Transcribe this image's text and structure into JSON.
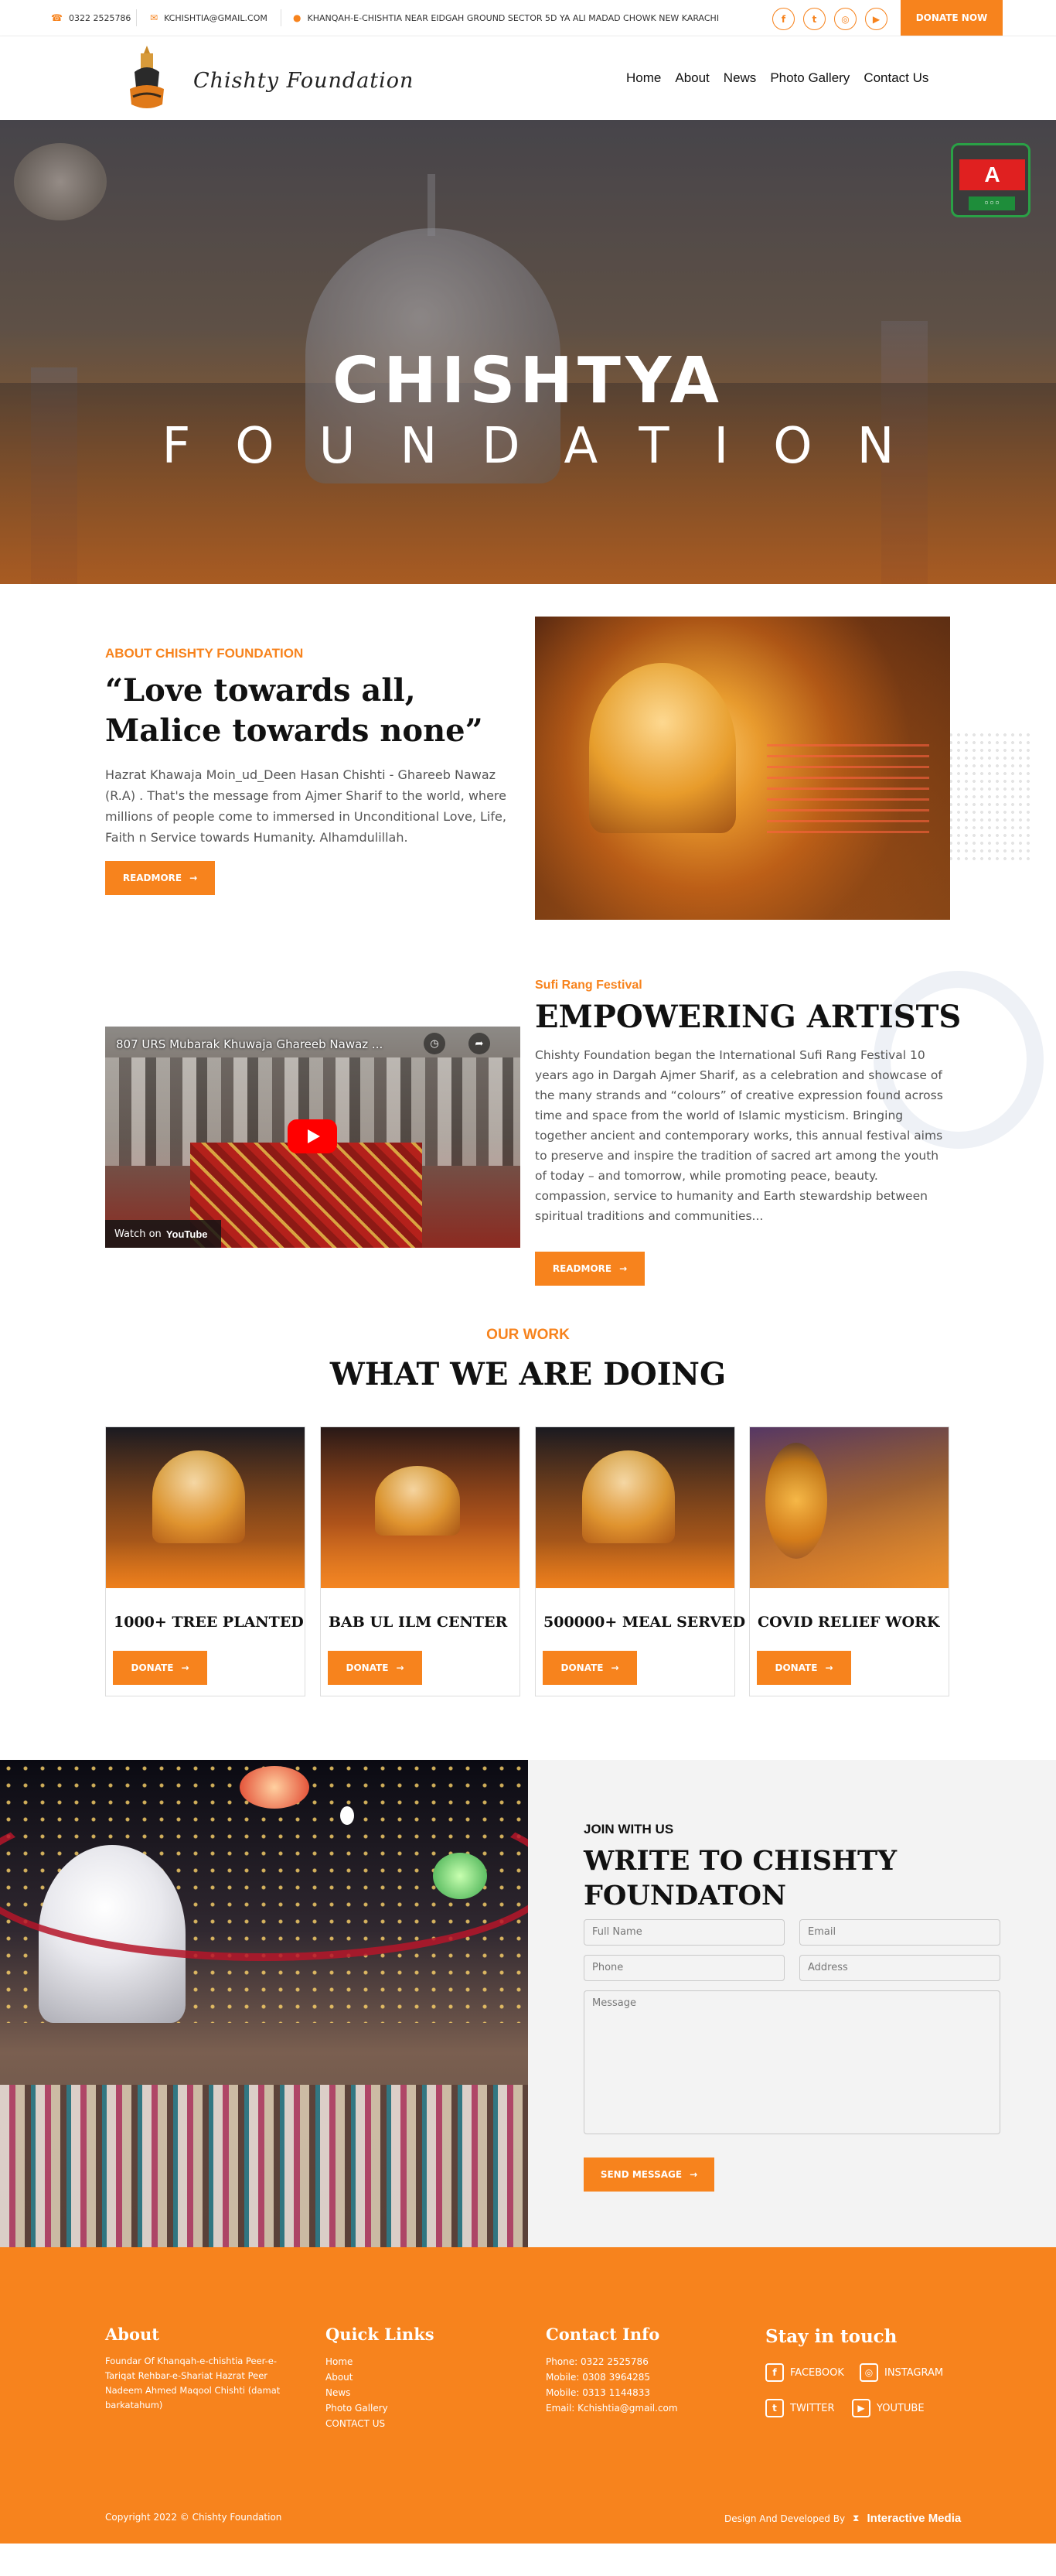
{
  "topbar": {
    "phone": "0322 2525786",
    "email": "KCHISHTIA@GMAIL.COM",
    "address": "KHANQAH-E-CHISHTIA NEAR EIDGAH GROUND SECTOR 5D YA ALI MADAD CHOWK NEW KARACHI",
    "social_icons": [
      "facebook-icon",
      "twitter-icon",
      "instagram-icon",
      "youtube-icon"
    ],
    "donate_label": "DONATE NOW"
  },
  "header": {
    "logo_text": "Chishty Foundation",
    "nav": [
      "Home",
      "About",
      "News",
      "Photo Gallery",
      "Contact Us"
    ]
  },
  "hero": {
    "title": "CHISHTYA",
    "subtitle": "FOUNDATION"
  },
  "about": {
    "kicker": "ABOUT CHISHTY FOUNDATION",
    "heading": "“Love towards all, Malice towards none”",
    "text": "Hazrat Khawaja Moin_ud_Deen Hasan Chishti - Ghareeb Nawaz (R.A) . That's the message from Ajmer Sharif to the world, where millions of people come to immersed in Unconditional Love, Life, Faith n Service towards Humanity. Alhamdulillah.",
    "button": "READMORE"
  },
  "sufi": {
    "kicker": "Sufi Rang Festival",
    "heading": "EMPOWERING ARTISTS",
    "text": "Chishty Foundation began the International Sufi Rang Festival 10 years ago in Dargah Ajmer Sharif, as a celebration and showcase of the many strands and “colours” of creative expression found across time and space from the world of Islamic mysticism. Bringing together ancient and contemporary works, this annual festival aims to preserve and inspire the tradition of sacred art among the youth of today – and tomorrow, while promoting peace, beauty. compassion, service to humanity and Earth stewardship between spiritual traditions and communities...",
    "button": "READMORE",
    "video": {
      "title": "807 URS Mubarak Khuwaja Ghareeb Nawaz ...",
      "watch_on": "Watch on",
      "platform": "YouTube"
    }
  },
  "work": {
    "kicker": "OUR WORK",
    "heading": "WHAT WE ARE DOING",
    "cards": [
      {
        "title": "1000+ TREE PLANTED",
        "button": "DONATE"
      },
      {
        "title": "BAB UL ILM CENTER",
        "button": "DONATE"
      },
      {
        "title": "500000+ MEAL SERVED",
        "button": "DONATE"
      },
      {
        "title": "COVID RELIEF WORK",
        "button": "DONATE"
      }
    ]
  },
  "contact": {
    "kicker": "JOIN WITH US",
    "heading": "WRITE TO CHISHTY FOUNDATON",
    "placeholders": {
      "name": "Full Name",
      "email": "Email",
      "phone": "Phone",
      "address": "Address",
      "message": "Message"
    },
    "button": "SEND MESSAGE"
  },
  "footer": {
    "about_title": "About",
    "about_text": "Foundar Of Khanqah-e-chishtia Peer-e-Tariqat Rehbar-e-Shariat Hazrat Peer Nadeem Ahmed Maqool Chishti (damat barkatahum)",
    "links_title": "Quick Links",
    "links": [
      "Home",
      "About",
      "News",
      "Photo Gallery",
      "CONTACT US"
    ],
    "contact_title": "Contact Info",
    "contact_lines": [
      "Phone: 0322 2525786",
      "Mobile: 0308 3964285",
      "Mobile: 0313 1144833",
      "Email: Kchishtia@gmail.com"
    ],
    "stay_title": "Stay in touch",
    "social": [
      "FACEBOOK",
      "INSTAGRAM",
      "TWITTER",
      "YOUTUBE"
    ],
    "copyright": "Copyright 2022 © Chishty Foundation",
    "developed_by": "Design And Developed By",
    "developer": "Interactive Media"
  },
  "colors": {
    "accent": "#f7831d"
  }
}
